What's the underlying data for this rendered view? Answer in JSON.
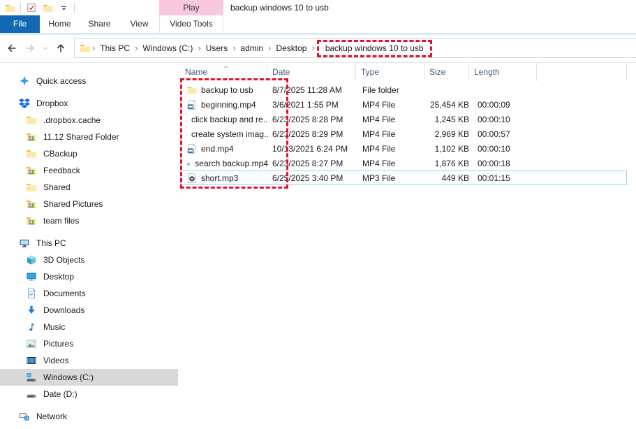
{
  "window": {
    "title": "backup windows 10 to usb",
    "qat_buttons": [
      "window-folder",
      "properties-check",
      "new-folder",
      "customize-quick-access"
    ]
  },
  "ribbon": {
    "tabs": {
      "file": "File",
      "home": "Home",
      "share": "Share",
      "view": "View"
    },
    "contextual_group": "Play",
    "contextual_tab": "Video Tools"
  },
  "addressbar": {
    "breadcrumbs": [
      "This PC",
      "Windows (C:)",
      "Users",
      "admin",
      "Desktop",
      "backup windows 10 to usb"
    ],
    "highlighted_crumb": "backup windows 10 to usb",
    "separator": "›"
  },
  "sidebar": {
    "items": [
      {
        "label": "Quick access",
        "icon": "star-icon",
        "level": 0
      },
      {
        "label": "Dropbox",
        "icon": "dropbox-icon",
        "level": 0
      },
      {
        "label": ".dropbox.cache",
        "icon": "folder-icon",
        "level": 1
      },
      {
        "label": "11.12 Shared Folder",
        "icon": "shared-folder-icon",
        "level": 1
      },
      {
        "label": "CBackup",
        "icon": "folder-icon",
        "level": 1
      },
      {
        "label": "Feedback",
        "icon": "shared-folder-icon",
        "level": 1
      },
      {
        "label": "Shared",
        "icon": "folder-icon",
        "level": 1
      },
      {
        "label": "Shared Pictures",
        "icon": "shared-folder-icon",
        "level": 1
      },
      {
        "label": "team files",
        "icon": "shared-folder-icon",
        "level": 1
      },
      {
        "label": "This PC",
        "icon": "computer-icon",
        "level": 0
      },
      {
        "label": "3D Objects",
        "icon": "cube-icon",
        "level": 1
      },
      {
        "label": "Desktop",
        "icon": "monitor-icon",
        "level": 1
      },
      {
        "label": "Documents",
        "icon": "document-icon",
        "level": 1
      },
      {
        "label": "Downloads",
        "icon": "download-arrow-icon",
        "level": 1
      },
      {
        "label": "Music",
        "icon": "music-note-icon",
        "level": 1
      },
      {
        "label": "Pictures",
        "icon": "picture-icon",
        "level": 1
      },
      {
        "label": "Videos",
        "icon": "film-icon",
        "level": 1
      },
      {
        "label": "Windows (C:)",
        "icon": "drive-windows-icon",
        "level": 1,
        "selected": true
      },
      {
        "label": "Date (D:)",
        "icon": "drive-icon",
        "level": 1
      },
      {
        "label": "Network",
        "icon": "network-icon",
        "level": 0
      }
    ]
  },
  "filelist": {
    "columns": [
      "Name",
      "Date",
      "Type",
      "Size",
      "Length"
    ],
    "sort": {
      "column": "Name",
      "direction": "ascending"
    },
    "rows": [
      {
        "name": "backup to usb",
        "icon": "folder-icon",
        "date": "8/7/2025 11:28 AM",
        "type": "File folder",
        "size": "",
        "length": ""
      },
      {
        "name": "beginning.mp4",
        "icon": "mp4-file-icon",
        "date": "3/6/2021 1:55 PM",
        "type": "MP4 File",
        "size": "25,454 KB",
        "length": "00:00:09"
      },
      {
        "name": "click backup and re...",
        "icon": "mp4-file-icon",
        "date": "6/23/2025 8:28 PM",
        "type": "MP4 File",
        "size": "1,245 KB",
        "length": "00:00:10"
      },
      {
        "name": "create system imag...",
        "icon": "mp4-file-icon",
        "date": "6/23/2025 8:29 PM",
        "type": "MP4 File",
        "size": "2,969 KB",
        "length": "00:00:57"
      },
      {
        "name": "end.mp4",
        "icon": "mp4-file-icon",
        "date": "10/13/2021 6:24 PM",
        "type": "MP4 File",
        "size": "1,102 KB",
        "length": "00:00:10"
      },
      {
        "name": "search backup.mp4",
        "icon": "mp4-file-icon",
        "date": "6/23/2025 8:27 PM",
        "type": "MP4 File",
        "size": "1,876 KB",
        "length": "00:00:18"
      },
      {
        "name": "short.mp3",
        "icon": "mp3-file-icon",
        "date": "6/25/2025 3:40 PM",
        "type": "MP3 File",
        "size": "449 KB",
        "length": "00:01:15",
        "selected": true
      }
    ]
  },
  "annotations": {
    "breadcrumb_box": "red dashed rectangle around current folder breadcrumb",
    "name_column_box": "red dashed rectangle around file name column"
  },
  "colors": {
    "file_tab_blue": "#1268b3",
    "contextual_pink": "#f8c8dc",
    "highlight_red": "#e8112d",
    "selected_row_border": "#9ed2f2",
    "sidebar_selected_gray": "#d9d9d9",
    "header_text": "#42597a"
  }
}
